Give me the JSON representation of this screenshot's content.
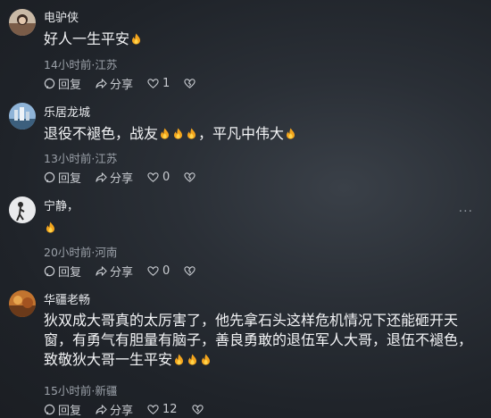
{
  "comments": [
    {
      "username": "电驴侠",
      "text_parts": [
        "好人一生平安"
      ],
      "fire_after": [
        1
      ],
      "meta": "14小时前·江苏",
      "reply_label": "回复",
      "share_label": "分享",
      "like_count": "1"
    },
    {
      "username": "乐居龙城",
      "text_parts": [
        "退役不褪色，战友",
        "，平凡中伟大"
      ],
      "fire_after": [
        3,
        1
      ],
      "meta": "13小时前·江苏",
      "reply_label": "回复",
      "share_label": "分享",
      "like_count": "0"
    },
    {
      "username": "宁静，",
      "text_parts": [
        ""
      ],
      "fire_after": [
        1
      ],
      "meta": "20小时前·河南",
      "reply_label": "回复",
      "share_label": "分享",
      "like_count": "0"
    },
    {
      "username": "华疆老畅",
      "text_parts": [
        "狄双成大哥真的太厉害了，他先拿石头这样危机情况下还能砸开天窗，有勇气有胆量有脑子，善良勇敢的退伍军人大哥，退伍不褪色，致敬狄大哥一生平安"
      ],
      "fire_after": [
        3
      ],
      "meta": "15小时前·新疆",
      "reply_label": "回复",
      "share_label": "分享",
      "like_count": "12"
    }
  ],
  "more_label": "···",
  "icons": {
    "reply": "reply-icon",
    "share": "share-icon",
    "like": "heart-icon",
    "dislike": "broken-heart-icon",
    "emoji": "fire-emoji"
  },
  "colors": {
    "fire_outer": "#f4a51d",
    "fire_inner": "#ffd44a",
    "meta_text": "#9aa0a8"
  }
}
